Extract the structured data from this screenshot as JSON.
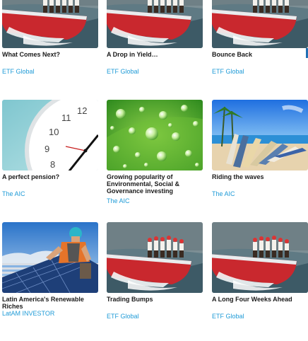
{
  "articles": [
    {
      "title": "What Comes Next?",
      "source": "ETF Global",
      "image": "sailing-boat-image"
    },
    {
      "title": "A Drop in Yield…",
      "source": "ETF Global",
      "image": "sailing-boat-image"
    },
    {
      "title": "Bounce Back",
      "source": "ETF Global",
      "image": "sailing-boat-image"
    },
    {
      "title": "A perfect pension?",
      "source": "The AIC",
      "image": "wall-clock-image"
    },
    {
      "title": "Growing popularity of Environmental, Social & Governance investing",
      "source": "The AIC",
      "image": "water-droplets-leaf-image"
    },
    {
      "title": "Riding the waves",
      "source": "The AIC",
      "image": "beach-surfboards-image"
    },
    {
      "title": "Latin America's Renewable Riches",
      "source": "LatAM INVESTOR",
      "image": "solar-panel-worker-image"
    },
    {
      "title": "Trading Bumps",
      "source": "ETF Global",
      "image": "sailing-boat-image"
    },
    {
      "title": "A Long Four Weeks Ahead",
      "source": "ETF Global",
      "image": "sailing-boat-image"
    }
  ],
  "colors": {
    "link": "#1f9bd7",
    "title": "#1a1a1a"
  }
}
